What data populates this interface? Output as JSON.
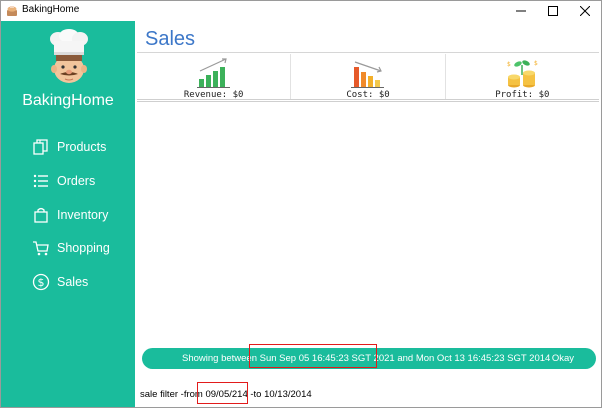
{
  "window": {
    "title": "BakingHome"
  },
  "sidebar": {
    "brand": "BakingHome",
    "items": [
      {
        "label": "Products",
        "icon": "products-icon"
      },
      {
        "label": "Orders",
        "icon": "list-icon"
      },
      {
        "label": "Inventory",
        "icon": "bag-icon"
      },
      {
        "label": "Shopping",
        "icon": "cart-icon"
      },
      {
        "label": "Sales",
        "icon": "dollar-circle-icon"
      }
    ]
  },
  "main": {
    "title": "Sales",
    "cards": [
      {
        "label": "Revenue: $0",
        "icon": "revenue-chart-icon"
      },
      {
        "label": "Cost: $0",
        "icon": "cost-chart-icon"
      },
      {
        "label": "Profit: $0",
        "icon": "profit-coins-icon"
      }
    ]
  },
  "status": {
    "prefix": "Showing between ",
    "from": "Sun Sep 05 16:45:23 SGT 2021",
    "middle": " and Mon Oct 13 16:45:23 SGT 2014",
    "ok_label": "Okay"
  },
  "filter": {
    "prefix": "sale filter -from ",
    "from": "09/05/214",
    "middle": " -to 10/13/2014"
  },
  "colors": {
    "sidebar": "#1abc9c",
    "title": "#3c77c8",
    "highlight": "#e21b1b"
  }
}
